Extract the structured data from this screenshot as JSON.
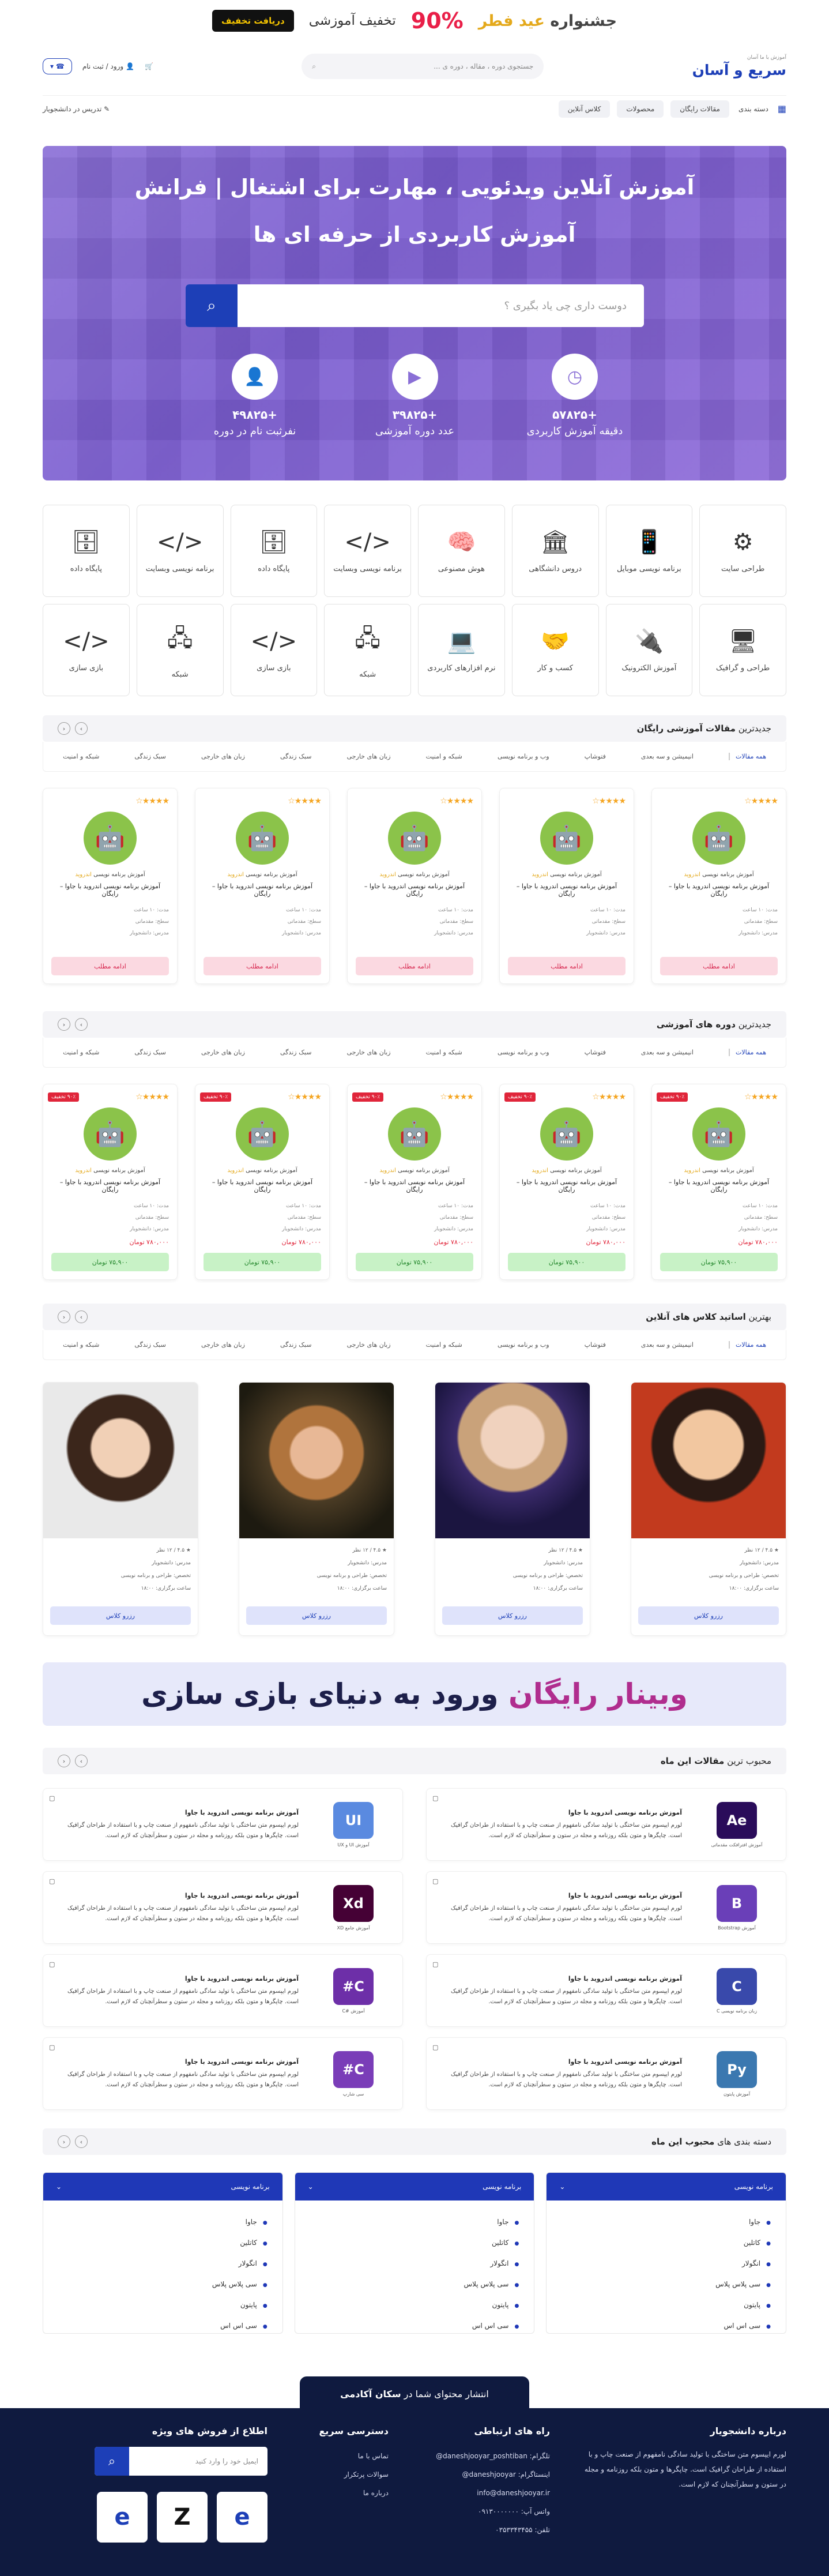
{
  "promo": {
    "title_a": "جشنواره",
    "title_b": "عید فطر",
    "percent": "90%",
    "discount": "تخفیف آموزشی",
    "button": "دریافت تخفیف"
  },
  "header": {
    "logo_sub": "آموزش با ما آسان",
    "logo": "سریع و آسان",
    "search_placeholder": "جستجوی دوره ، مقاله ، دوره ی ...",
    "login": "ورود / ثبت نام"
  },
  "nav": {
    "items": [
      "دسته بندی",
      "مقالات رایگان",
      "محصولات",
      "کلاس آنلاین"
    ],
    "teach": "تدریس در دانشجویار"
  },
  "hero": {
    "title1": "آموزش آنلاین ویدئویی ، مهارت برای اشتغال | فرانش",
    "title2": "آموزش کاربردی از حرفه ای ها",
    "search_placeholder": "دوست داری چی یاد بگیری ؟",
    "stats": [
      {
        "num": "+۵۷۸۲۵",
        "label": "دقیقه آموزش کاربردی",
        "icon": "clock-icon"
      },
      {
        "num": "+۳۹۸۲۵",
        "label": "عدد دوره آموزشی",
        "icon": "play-icon"
      },
      {
        "num": "+۴۹۸۲۵",
        "label": "نفرثبت نام در دوره",
        "icon": "add-user-icon"
      }
    ]
  },
  "categories": [
    {
      "label": "طراحی سایت",
      "icon": "⚙"
    },
    {
      "label": "برنامه نویسی موبایل",
      "icon": "📱"
    },
    {
      "label": "دروس دانشگاهی",
      "icon": "🏛"
    },
    {
      "label": "هوش مصنوعی",
      "icon": "🧠"
    },
    {
      "label": "برنامه نویسی وبسایت",
      "icon": "</>"
    },
    {
      "label": "پایگاه داده",
      "icon": "🗄"
    },
    {
      "label": "برنامه نویسی وبسایت",
      "icon": "</>"
    },
    {
      "label": "پایگاه داده",
      "icon": "🗄"
    },
    {
      "label": "طراحی و گرافیک",
      "icon": "🖥"
    },
    {
      "label": "آموزش الکترونیک",
      "icon": "🔌"
    },
    {
      "label": "کسب و کار",
      "icon": "🤝"
    },
    {
      "label": "نرم افزارهای کاربردی",
      "icon": "💻"
    },
    {
      "label": "شبکه",
      "icon": "🖧"
    },
    {
      "label": "بازی سازی",
      "icon": "</>"
    },
    {
      "label": "شبکه",
      "icon": "🖧"
    },
    {
      "label": "بازی سازی",
      "icon": "</>"
    }
  ],
  "tabs": [
    "همه مقالات",
    "انیمیشن و سه بعدی",
    "فتوشاپ",
    "وب و برنامه نویسی",
    "شبکه و امنیت",
    "زبان های خارجی",
    "سبک زندگی",
    "زبان های خارجی",
    "سبک زندگی",
    "شبکه و امنیت"
  ],
  "articles_section": {
    "title_pre": "جدیدترین",
    "title": "مقالات آموزشی رایگان"
  },
  "article_cards": {
    "category_pre": "آموزش برنامه نویسی",
    "category": "اندروید",
    "title": "آموزش برنامه نویسی اندروید با جاوا – رایگان",
    "meta": [
      "مدت: ۱۰ ساعت",
      "سطح: مقدماتی",
      "مدرس: دانشجویار"
    ],
    "button": "ادامه مطلب"
  },
  "courses_section": {
    "title_pre": "جدیدترین",
    "title": "دوره های آموزشی"
  },
  "course_cards": {
    "badge": "۹۰٪ تخفیف",
    "old_price": "۷۸۰,۰۰۰ تومان",
    "price": "۷۵,۹۰۰ تومان"
  },
  "masters_section": {
    "title_pre": "بهترین",
    "title": "اساتید کلاس های آنلاین"
  },
  "masters": {
    "meta": [
      "★ ۴.۵ / ۱۲ نظر",
      "مدرس: دانشجویار",
      "تخصص: طراحی و برنامه نویسی",
      "ساعت برگزاری: ۱۸:۰۰"
    ],
    "button": "رزرو کلاس"
  },
  "webinar": {
    "highlight": "وبینار رایگان",
    "text": "ورود به دنیای بازی سازی"
  },
  "popular_section": {
    "title_pre": "محبوب ترین",
    "title": "مقالات این ماه"
  },
  "popular_articles": [
    {
      "thumb_label": "آموزش افترافکت مقدماتی",
      "logo": "Ae",
      "color": "#2a0c5a"
    },
    {
      "thumb_label": "آموزش UI و UX",
      "logo": "UI",
      "color": "#5a8ae0"
    },
    {
      "thumb_label": "آموزش Bootstrap",
      "logo": "B",
      "color": "#6a3fb8"
    },
    {
      "thumb_label": "آموزش جامع XD",
      "logo": "Xd",
      "color": "#450135"
    },
    {
      "thumb_label": "زبان برنامه نویسی C",
      "logo": "C",
      "color": "#3949ab"
    },
    {
      "thumb_label": "آموزش #C",
      "logo": "C#",
      "color": "#6d2fa8"
    },
    {
      "thumb_label": "آموزش پایتون",
      "logo": "Py",
      "color": "#3b78b0"
    },
    {
      "thumb_label": "سی شارپ",
      "logo": "C#",
      "color": "#7a3db8"
    }
  ],
  "popular_article_text": {
    "title": "آموزش برنامه نویسی اندروید با جاوا",
    "body": "لورم ایپسوم متن ساختگی با تولید سادگی نامفهوم از صنعت چاپ و با استفاده از طراحان گرافیک است. چاپگرها و متون بلکه روزنامه و مجله در ستون و سطرآنچنان که لازم است."
  },
  "cat_section": {
    "title_pre": "دسته بندی های",
    "title": "محبوب این ماه"
  },
  "cat_lists": {
    "header": "برنامه نویسی",
    "items": [
      "جاوا",
      "کاتلین",
      "انگولار",
      "سی پلاس پلاس",
      "پایتون",
      "سی اس اس"
    ]
  },
  "footer": {
    "tab_pre": "انتشار محتوای شما در",
    "tab_brand": "سکان آکادمی",
    "about_title": "درباره دانشجویار",
    "about_text": "لورم ایپسوم متن ساختگی با تولید سادگی نامفهوم از صنعت چاپ و با استفاده از طراحان گرافیک است. چاپگرها و متون بلکه روزنامه و مجله در ستون و سطرآنچنان که لازم است.",
    "contact_title": "راه های ارتباطی",
    "contact": [
      "تلگرام: daneshjooyar_poshtiban@",
      "اینستاگرام: daneshjooyar@",
      "info@daneshjooyar.ir",
      "واتس آپ: ۰۹۱۳۰۰۰۰۰۰۰",
      "تلفن: ۰۳۵۳۳۴۳۴۵۵"
    ],
    "quick_title": "دسترسی سریع",
    "quick": [
      "تماس با ما",
      "سوالات پرتکرار",
      "درباره ما"
    ],
    "news_title": "اطلاع از فروش های ویژه",
    "news_placeholder": "ایمیل خود را وارد کنید"
  }
}
